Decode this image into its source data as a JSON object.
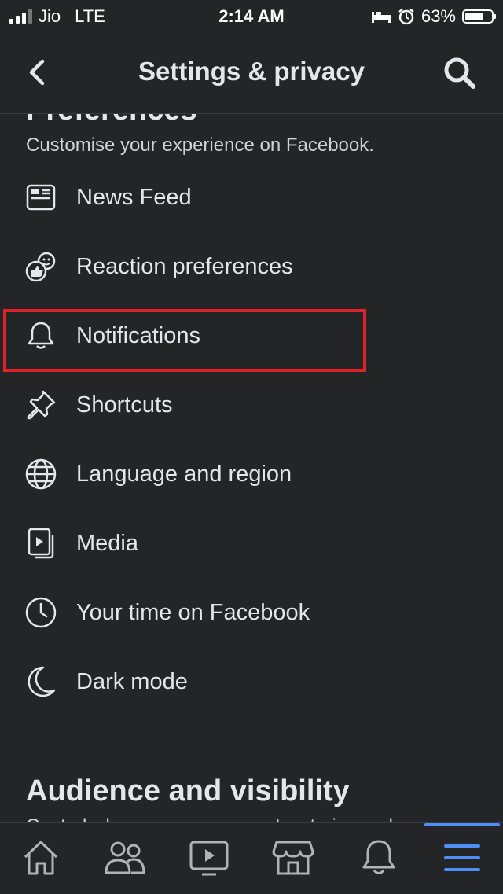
{
  "status_bar": {
    "carrier": "Jio",
    "network": "LTE",
    "time": "2:14 AM",
    "battery_percent": "63%",
    "battery_level": 0.63
  },
  "header": {
    "title": "Settings & privacy",
    "back_icon": "chevron-left-icon",
    "search_icon": "search-icon"
  },
  "preferences": {
    "title": "Preferences",
    "subtitle": "Customise your experience on Facebook.",
    "items": [
      {
        "label": "News Feed",
        "icon": "news-feed-icon"
      },
      {
        "label": "Reaction preferences",
        "icon": "reaction-icon"
      },
      {
        "label": "Notifications",
        "icon": "bell-icon"
      },
      {
        "label": "Shortcuts",
        "icon": "pin-icon"
      },
      {
        "label": "Language and region",
        "icon": "globe-icon"
      },
      {
        "label": "Media",
        "icon": "media-icon"
      },
      {
        "label": "Your time on Facebook",
        "icon": "clock-icon"
      },
      {
        "label": "Dark mode",
        "icon": "moon-icon"
      }
    ]
  },
  "audience": {
    "title": "Audience and visibility",
    "subtitle": "Control who can see your posts, stories and"
  },
  "tabbar": {
    "tabs": [
      "home-icon",
      "friends-icon",
      "watch-icon",
      "marketplace-icon",
      "notifications-icon",
      "menu-icon"
    ],
    "active": "menu-icon",
    "accent": "#4e8ef7"
  },
  "colors": {
    "background": "#242526",
    "highlight_border": "#e0222a"
  }
}
